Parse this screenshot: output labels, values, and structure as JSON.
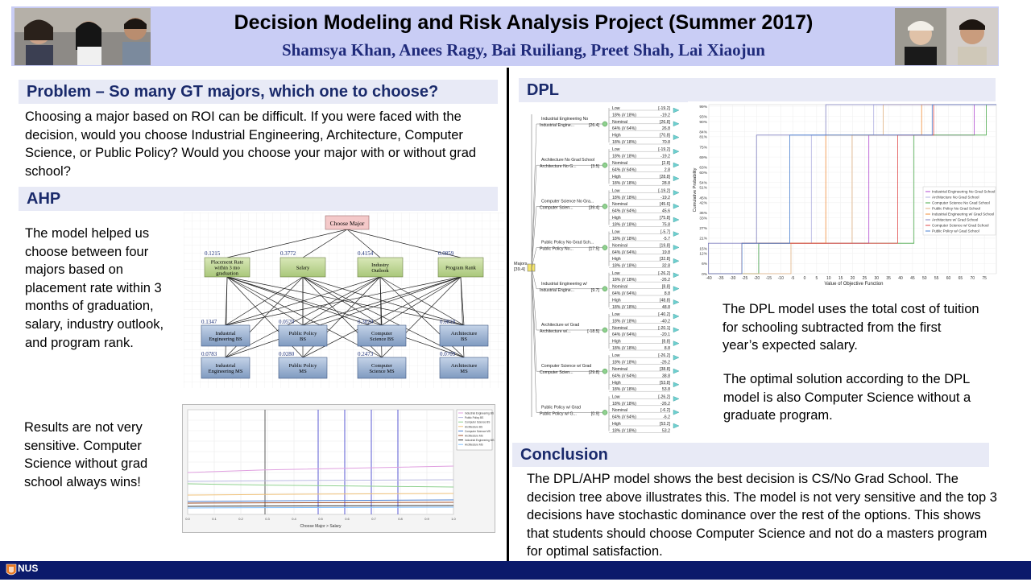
{
  "header": {
    "title": "Decision Modeling and Risk Analysis Project (Summer 2017)",
    "authors": "Shamsya Khan, Anees Ragy, Bai Ruiliang, Preet Shah, Lai Xiaojun"
  },
  "problem": {
    "heading": "Problem – So many GT majors, which one to choose?",
    "text": "Choosing a major based on ROI can be difficult. If you were faced with the decision, would you choose Industrial Engineering, Architecture, Computer Science, or Public Policy? Would you choose your major with or without grad school?"
  },
  "ahp": {
    "heading": "AHP",
    "text": "The model helped us choose between four majors based on placement rate within 3 months of graduation, salary, industry outlook, and program rank.",
    "diagram": {
      "goal": "Choose Major",
      "criteria": [
        {
          "label": "Placement Rate within 3 mo graduation",
          "weight": "0.1215"
        },
        {
          "label": "Salary",
          "weight": "0.3772"
        },
        {
          "label": "Industry Outlook",
          "weight": "0.4154"
        },
        {
          "label": "Program Rank",
          "weight": "0.0859"
        }
      ],
      "alternatives": [
        {
          "label": "Industrial Engineering BS",
          "weight": "0.1347"
        },
        {
          "label": "Public Policy BS",
          "weight": "0.0570"
        },
        {
          "label": "Computer Science BS",
          "weight": "0.3020"
        },
        {
          "label": "Architecture BS",
          "weight": "0.0818"
        },
        {
          "label": "Industrial Engineering MS",
          "weight": "0.0783"
        },
        {
          "label": "Public Policy MS",
          "weight": "0.0280"
        },
        {
          "label": "Computer Science MS",
          "weight": "0.2473"
        },
        {
          "label": "Architecture MS",
          "weight": "0.0709"
        }
      ]
    }
  },
  "sensitivity": {
    "text": "Results are not very sensitive. Computer Science without grad school always wins!",
    "xlabel": "Choose Major > Salary",
    "legend": [
      "Industrial Engineering BS",
      "Public Policy BS",
      "Computer Science BS",
      "Architecture BS",
      "Computer Science MS",
      "Architecture MS",
      "Industrial Engineering MS",
      "Architecture MS"
    ]
  },
  "dpl": {
    "heading": "DPL",
    "text1": "The DPL model uses the total cost of tuition for schooling subtracted from the first year’s expected salary.",
    "text2": "The optimal solution according to the DPL model is also Computer Science without a graduate program.",
    "tree": {
      "root_label": "Majors",
      "root_value": "[39.4]",
      "branches": [
        {
          "title": "Industrial Engineering No",
          "sub": "Industrial Engine...",
          "value": "[26.4]",
          "vals": [
            "[-19.2]",
            "-19.2",
            "[26.8]",
            "26.8",
            "[70.8]",
            "70.8"
          ]
        },
        {
          "title": "Architecture No Grad School",
          "sub": "Architecture No G...",
          "value": "[3.5]",
          "vals": [
            "[-19.2]",
            "-19.2",
            "[2.8]",
            "2.8",
            "[28.8]",
            "28.8"
          ]
        },
        {
          "title": "Computer Science No Gra...",
          "sub": "Computer Scien...",
          "value": "[39.4]",
          "vals": [
            "[-19.2]",
            "-19.2",
            "[45.6]",
            "45.6",
            "[75.8]",
            "75.8"
          ]
        },
        {
          "title": "Public Policy No Grad Sch...",
          "sub": "Public Policy No...",
          "value": "[17.5]",
          "vals": [
            "[-5.7]",
            "-5.7",
            "[19.8]",
            "19.8",
            "[32.8]",
            "32.8"
          ]
        },
        {
          "title": "Industrial Engineering w/",
          "sub": "Industrial Engine...",
          "value": "[9.7]",
          "vals": [
            "[-26.2]",
            "-26.2",
            "[8.8]",
            "8.8",
            "[48.8]",
            "48.8"
          ]
        },
        {
          "title": "Architecture w/ Grad",
          "sub": "Architecture w/...",
          "value": "[-18.5]",
          "vals": [
            "[-40.2]",
            "-40.2",
            "[-20.1]",
            "-20.1",
            "[8.8]",
            "8.8"
          ]
        },
        {
          "title": "Computer Science w/ Grad",
          "sub": "Computer Scien...",
          "value": "[29.8]",
          "vals": [
            "[-26.2]",
            "-26.2",
            "[38.8]",
            "38.8",
            "[53.8]",
            "53.8"
          ]
        },
        {
          "title": "Public Policy w/ Grad",
          "sub": "Public Policy w/ G...",
          "value": "[0.9]",
          "vals": [
            "[-26.2]",
            "-26.2",
            "[-6.2]",
            "-6.2",
            "[53.2]",
            "53.2"
          ]
        }
      ],
      "outcome_labels": [
        "Low",
        "18% (// 18%)",
        "Nominal",
        "64% (// 64%)",
        "High",
        "18% (// 18%)"
      ]
    },
    "cdf": {
      "ylabel": "Cumulative Probability",
      "xlabel": "Value of Objective Function",
      "yticks": [
        "99%",
        "93%",
        "90%",
        "84%",
        "81%",
        "75%",
        "69%",
        "63%",
        "60%",
        "54%",
        "51%",
        "45%",
        "42%",
        "36%",
        "33%",
        "27%",
        "21%",
        "15%",
        "12%",
        "6%",
        "0%"
      ],
      "xticks": [
        "-40",
        "-35",
        "-30",
        "-25",
        "-20",
        "-15",
        "-10",
        "-5",
        "0",
        "5",
        "10",
        "15",
        "20",
        "25",
        "30",
        "35",
        "40",
        "45",
        "50",
        "55",
        "60",
        "65",
        "70",
        "75"
      ],
      "legend": [
        "Industrial Engineering No Grad School",
        "Architecture No Grad School",
        "Computer Science No Grad School",
        "Public Policy No Grad School",
        "Industrial Engineering w/ Grad School",
        "Architecture w/ Grad School",
        "Computer Science w/ Grad School",
        "Public Policy w/ Grad School"
      ]
    }
  },
  "conclusion": {
    "heading": "Conclusion",
    "text": "The DPL/AHP model shows the best decision is CS/No Grad School. The decision tree above illustrates this. The model is not very sensitive and the top 3 decisions have stochastic dominance over the rest of the options. This shows that students should choose Computer Science and not do a masters program for optimal satisfaction."
  },
  "footer": {
    "logo_text": "NUS"
  },
  "colors": {
    "header_band": "#c9cdf5",
    "section_bg": "#e8eaf6",
    "section_text": "#1a2a6b",
    "footer": "#0b1a6b"
  }
}
